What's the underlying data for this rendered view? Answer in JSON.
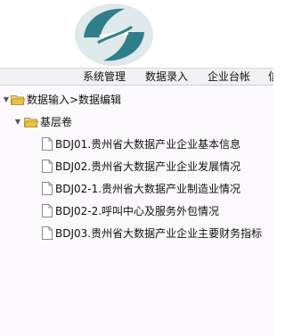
{
  "menubar": {
    "items": [
      {
        "label": "系统管理"
      },
      {
        "label": "数据录入"
      },
      {
        "label": "企业台帐"
      },
      {
        "label": "信"
      }
    ]
  },
  "tree": {
    "root": {
      "label": "数据输入>数据编辑",
      "toggle": "▼"
    },
    "group": {
      "label": "基层卷",
      "toggle": "▼"
    },
    "items": [
      {
        "label": "BDJ01.贵州省大数据产业企业基本信息"
      },
      {
        "label": "BDJ02.贵州省大数据产业企业发展情况"
      },
      {
        "label": "BDJ02-1.贵州省大数据产业制造业情况"
      },
      {
        "label": "BDJ02-2.呼叫中心及服务外包情况"
      },
      {
        "label": "BDJ03.贵州省大数据产业企业主要财务指标"
      }
    ]
  },
  "colors": {
    "logo_teal": "#2e7f87",
    "folder_yellow": "#e8c34a",
    "menu_bg": "#f1f1f3",
    "panel_bg": "#fbf9fb"
  },
  "icons": {
    "logo": "company-logo",
    "folder": "folder-open-icon",
    "document": "document-icon"
  }
}
